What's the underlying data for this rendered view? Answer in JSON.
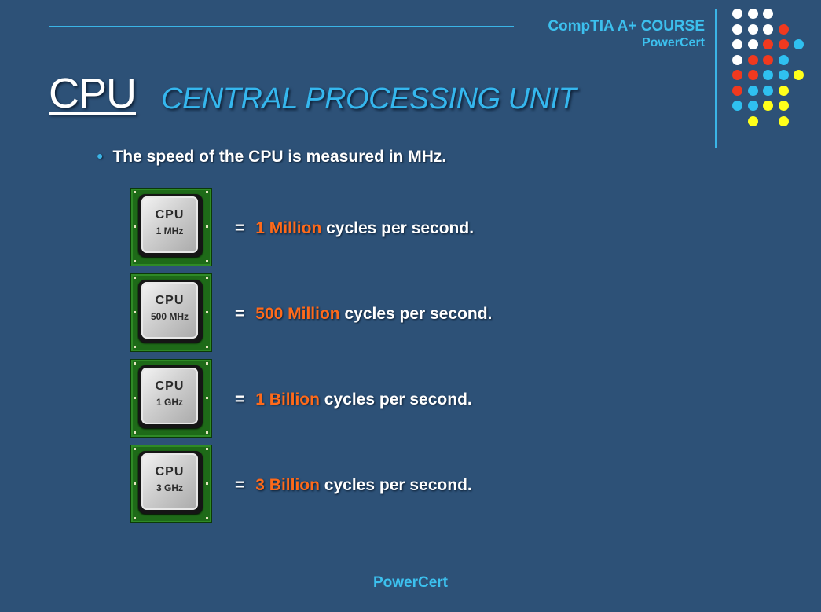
{
  "header": {
    "course": "CompTIA A+ COURSE",
    "brand": "PowerCert"
  },
  "title": {
    "main": "CPU",
    "sub": "CENTRAL PROCESSING UNIT"
  },
  "bullet": "The speed of the CPU is measured in MHz.",
  "rows": [
    {
      "chip_title": "CPU",
      "chip_speed": "1 MHz",
      "equals": "=",
      "highlight": "1 Million",
      "rest": "cycles per second."
    },
    {
      "chip_title": "CPU",
      "chip_speed": "500 MHz",
      "equals": "=",
      "highlight": "500 Million",
      "rest": "cycles per second."
    },
    {
      "chip_title": "CPU",
      "chip_speed": "1 GHz",
      "equals": "=",
      "highlight": "1 Billion",
      "rest": "cycles per second."
    },
    {
      "chip_title": "CPU",
      "chip_speed": "3 GHz",
      "equals": "=",
      "highlight": "3 Billion",
      "rest": "cycles per second."
    }
  ],
  "footer": "PowerCert",
  "colors": {
    "background": "#2d5177",
    "accent_blue": "#3ab4e6",
    "highlight_orange": "#ff6a1a",
    "dot_white": "#ffffff",
    "dot_red": "#f0391f",
    "dot_blue": "#2fc0f0",
    "dot_yellow": "#ffff1a"
  },
  "decor_dots": [
    [
      "white",
      "white",
      "white",
      "none",
      "none"
    ],
    [
      "white",
      "white",
      "white",
      "red",
      "none"
    ],
    [
      "white",
      "white",
      "red",
      "red",
      "blue"
    ],
    [
      "white",
      "red",
      "red",
      "blue",
      "none"
    ],
    [
      "red",
      "red",
      "blue",
      "blue",
      "yellow"
    ],
    [
      "red",
      "blue",
      "blue",
      "yellow",
      "none"
    ],
    [
      "blue",
      "blue",
      "yellow",
      "yellow",
      "none"
    ],
    [
      "none",
      "yellow",
      "none",
      "yellow",
      "none"
    ]
  ]
}
